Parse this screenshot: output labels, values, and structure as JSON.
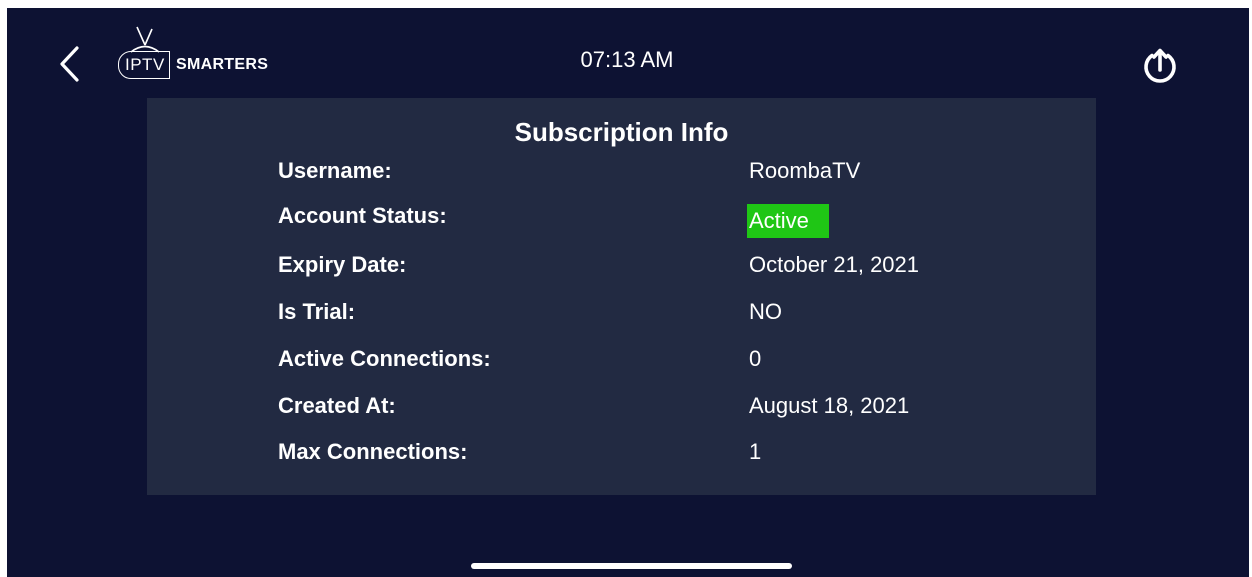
{
  "header": {
    "logo_left": "IPTV",
    "logo_right": "SMARTERS",
    "time": "07:13 AM"
  },
  "subscription": {
    "title": "Subscription Info",
    "rows": [
      {
        "label": "Username:",
        "value": "RoombaTV"
      },
      {
        "label": "Account Status:",
        "value": "Active"
      },
      {
        "label": "Expiry Date:",
        "value": "October 21, 2021"
      },
      {
        "label": "Is Trial:",
        "value": "NO"
      },
      {
        "label": "Active Connections:",
        "value": "0"
      },
      {
        "label": "Created At:",
        "value": "August 18, 2021"
      },
      {
        "label": "Max Connections:",
        "value": "1"
      }
    ]
  },
  "icons": {
    "back": "chevron-left-icon",
    "logout": "power-upload-icon",
    "antenna": "tv-antenna-icon"
  },
  "colors": {
    "background": "#0d1233",
    "panel": "#222a42",
    "active_badge": "#1fc615",
    "text": "#ffffff"
  }
}
